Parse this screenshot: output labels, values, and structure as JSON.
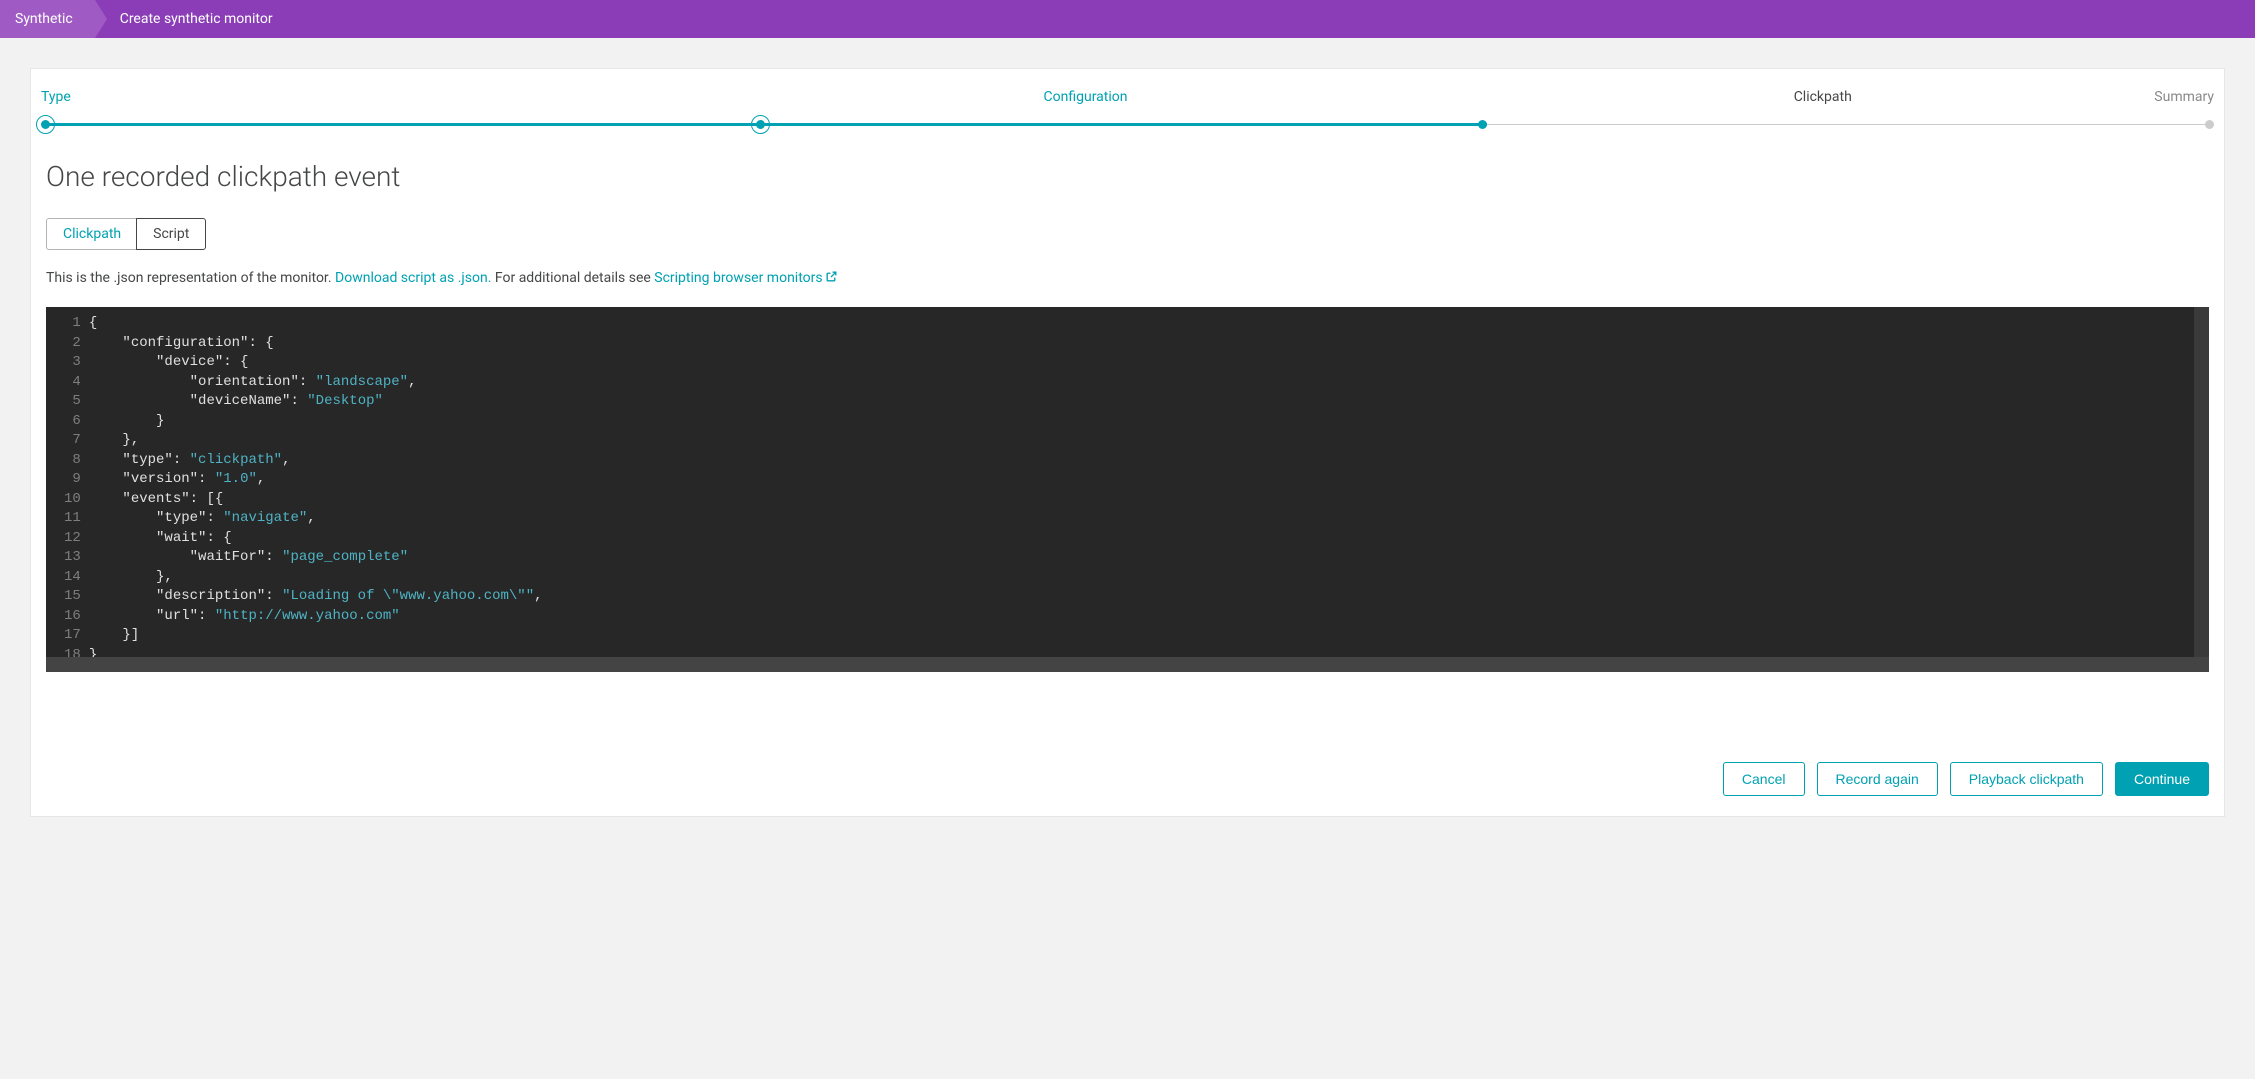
{
  "breadcrumb": {
    "items": [
      "Synthetic",
      "Create synthetic monitor"
    ]
  },
  "steps": {
    "items": [
      {
        "label": "Type",
        "state": "done"
      },
      {
        "label": "Configuration",
        "state": "done"
      },
      {
        "label": "Clickpath",
        "state": "current"
      },
      {
        "label": "Summary",
        "state": "future"
      }
    ]
  },
  "page": {
    "title": "One recorded clickpath event"
  },
  "tabs": {
    "clickpath": "Clickpath",
    "script": "Script"
  },
  "description": {
    "pre": "This is the .json representation of the monitor. ",
    "download": "Download script as .json.",
    "mid": " For additional details see ",
    "docs": "Scripting browser monitors"
  },
  "code": {
    "line_count": 18,
    "json": {
      "configuration": {
        "device": {
          "orientation": "landscape",
          "deviceName": "Desktop"
        }
      },
      "type": "clickpath",
      "version": "1.0",
      "events": [
        {
          "type": "navigate",
          "wait": {
            "waitFor": "page_complete"
          },
          "description": "Loading of \"www.yahoo.com\"",
          "url": "http://www.yahoo.com"
        }
      ]
    }
  },
  "footer": {
    "cancel": "Cancel",
    "record_again": "Record again",
    "playback": "Playback clickpath",
    "continue": "Continue"
  }
}
